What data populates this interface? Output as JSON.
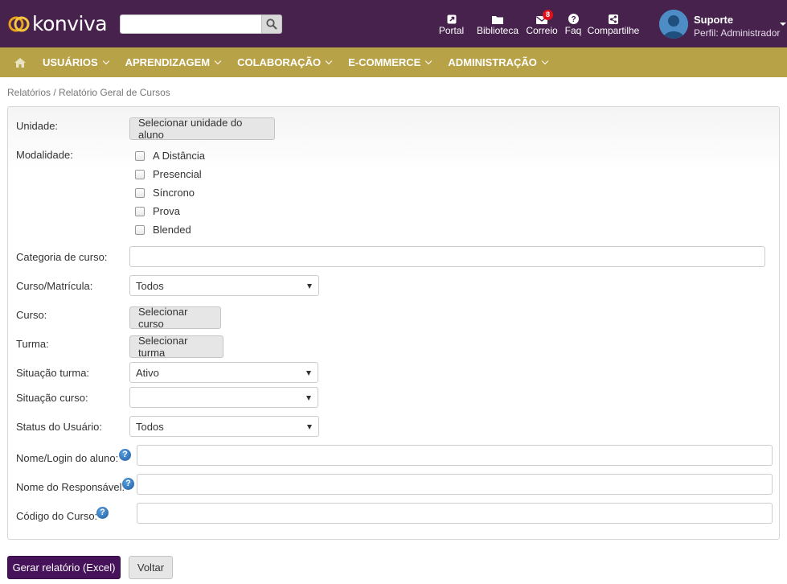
{
  "header": {
    "logo_text": "konviva",
    "search": {
      "value": "",
      "placeholder": ""
    },
    "icons": [
      {
        "icon": "external-link-icon",
        "label": "Portal"
      },
      {
        "icon": "folder-icon",
        "label": "Biblioteca"
      },
      {
        "icon": "mail-icon",
        "label": "Correio",
        "badge": "8"
      },
      {
        "icon": "question-icon",
        "label": "Faq"
      },
      {
        "icon": "share-icon",
        "label": "Compartilhe"
      }
    ],
    "user": {
      "name": "Suporte",
      "role": "Perfil: Administrador"
    }
  },
  "nav": {
    "items": [
      {
        "label": "USUÁRIOS"
      },
      {
        "label": "APRENDIZAGEM"
      },
      {
        "label": "COLABORAÇÃO"
      },
      {
        "label": "E-COMMERCE"
      },
      {
        "label": "ADMINISTRAÇÃO"
      }
    ]
  },
  "breadcrumb": "Relatórios / Relatório Geral de Cursos",
  "form": {
    "unidade": {
      "label": "Unidade:",
      "button": "Selecionar unidade do aluno"
    },
    "modalidade": {
      "label": "Modalidade:",
      "options": [
        {
          "label": "A Distância",
          "checked": false
        },
        {
          "label": "Presencial",
          "checked": false
        },
        {
          "label": "Síncrono",
          "checked": false
        },
        {
          "label": "Prova",
          "checked": false
        },
        {
          "label": "Blended",
          "checked": false
        }
      ]
    },
    "categoria": {
      "label": "Categoria de curso:",
      "value": ""
    },
    "curso_matricula": {
      "label": "Curso/Matrícula:",
      "value": "Todos"
    },
    "curso": {
      "label": "Curso:",
      "button": "Selecionar curso"
    },
    "turma": {
      "label": "Turma:",
      "button": "Selecionar turma"
    },
    "situacao_turma": {
      "label": "Situação turma:",
      "value": "Ativo"
    },
    "situacao_curso": {
      "label": "Situação curso:",
      "value": ""
    },
    "status_usuario": {
      "label": "Status do Usuário:",
      "value": "Todos"
    },
    "nome_login": {
      "label": "Nome/Login do aluno:",
      "value": ""
    },
    "nome_responsavel": {
      "label": "Nome do Responsável:",
      "value": ""
    },
    "codigo_curso": {
      "label": "Código do Curso:",
      "value": ""
    },
    "help_glyph": "?"
  },
  "actions": {
    "generate": "Gerar relatório (Excel)",
    "back": "Voltar"
  },
  "colors": {
    "topbar": "#46224d",
    "navbar": "#b8a248",
    "primary": "#46135a",
    "badge": "#e0111c"
  }
}
